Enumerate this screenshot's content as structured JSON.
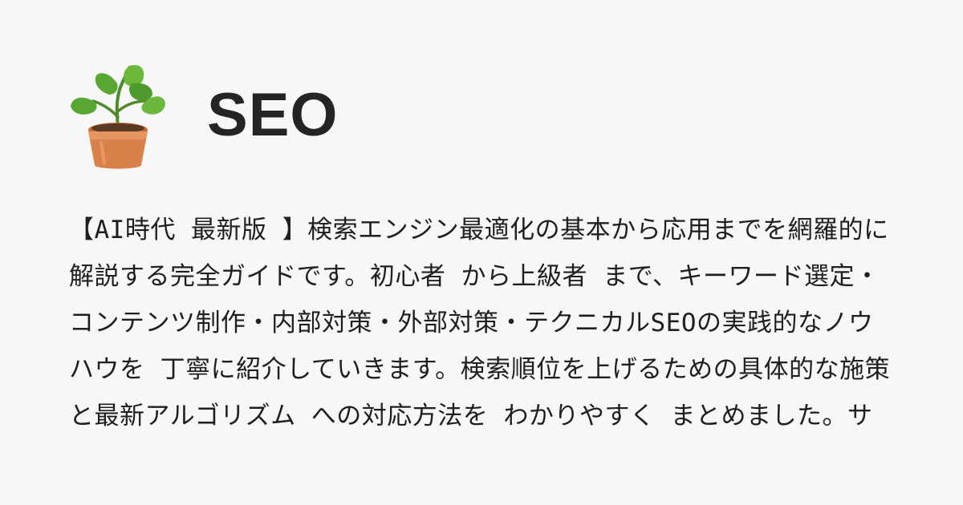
{
  "card": {
    "title": "SEO",
    "icon": "potted-plant-icon",
    "description": "【AI時代 最新版 】検索エンジン最適化の基本から応用までを網羅的に解説する完全ガイドです。初心者 から上級者 まで、キーワード選定・コンテンツ制作・内部対策・外部対策・テクニカルSEOの実践的なノウハウを 丁寧に紹介していきます。検索順位を上げるための具体的な施策と最新アルゴリズム への対応方法を わかりやすく まとめました。サイト運営者 必見の内容 …",
    "colors": {
      "background": "#f8f7f8",
      "text": "#1f1f1f",
      "pot": "#d9814a",
      "leaf": "#5aa632"
    }
  }
}
